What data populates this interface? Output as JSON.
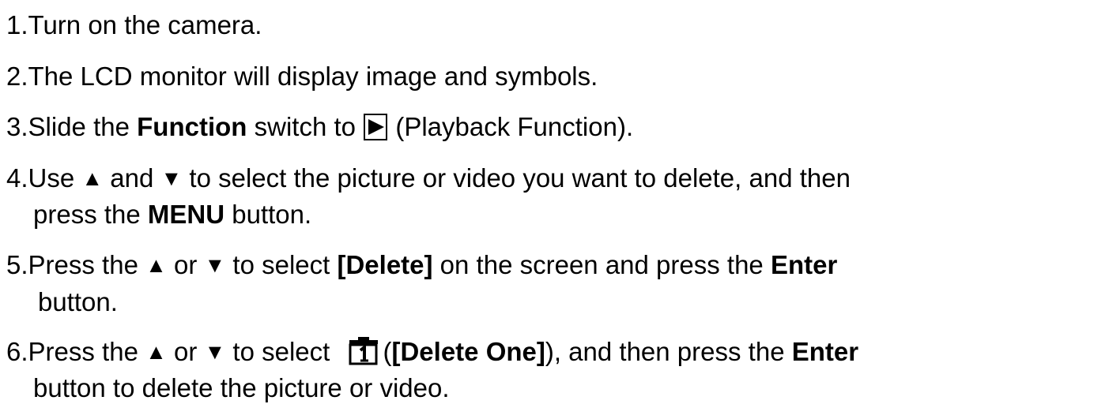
{
  "steps": [
    {
      "text": "1.Turn on the camera."
    },
    {
      "text": "2.The LCD monitor will display image and symbols."
    },
    {
      "a": "3.Slide the ",
      "b_function": "Function",
      "c": " switch to ",
      "d": " (Playback Function)."
    },
    {
      "a": "4.Use ",
      "up": "▲",
      "b": " and ",
      "down": "▼",
      "c": " to select the picture or video you want to delete, and then",
      "d": "press the ",
      "menu": "MENU",
      "e": " button."
    },
    {
      "a": "5.Press the ",
      "up": "▲",
      "b": " or ",
      "down": "▼",
      "c": " to select ",
      "delete": "[Delete]",
      "d": " on the screen and press the ",
      "enter": "Enter",
      "e": "button."
    },
    {
      "a": "6.Press the ",
      "up": "▲",
      "b": " or ",
      "down": "▼",
      "c": " to select ",
      "d": "(",
      "delete_one": "[Delete One]",
      "e": "), and then press the ",
      "enter": "Enter",
      "f": "button to delete the picture or video."
    }
  ],
  "icons": {
    "play": "play-icon",
    "delete_one": "delete-one-icon"
  }
}
